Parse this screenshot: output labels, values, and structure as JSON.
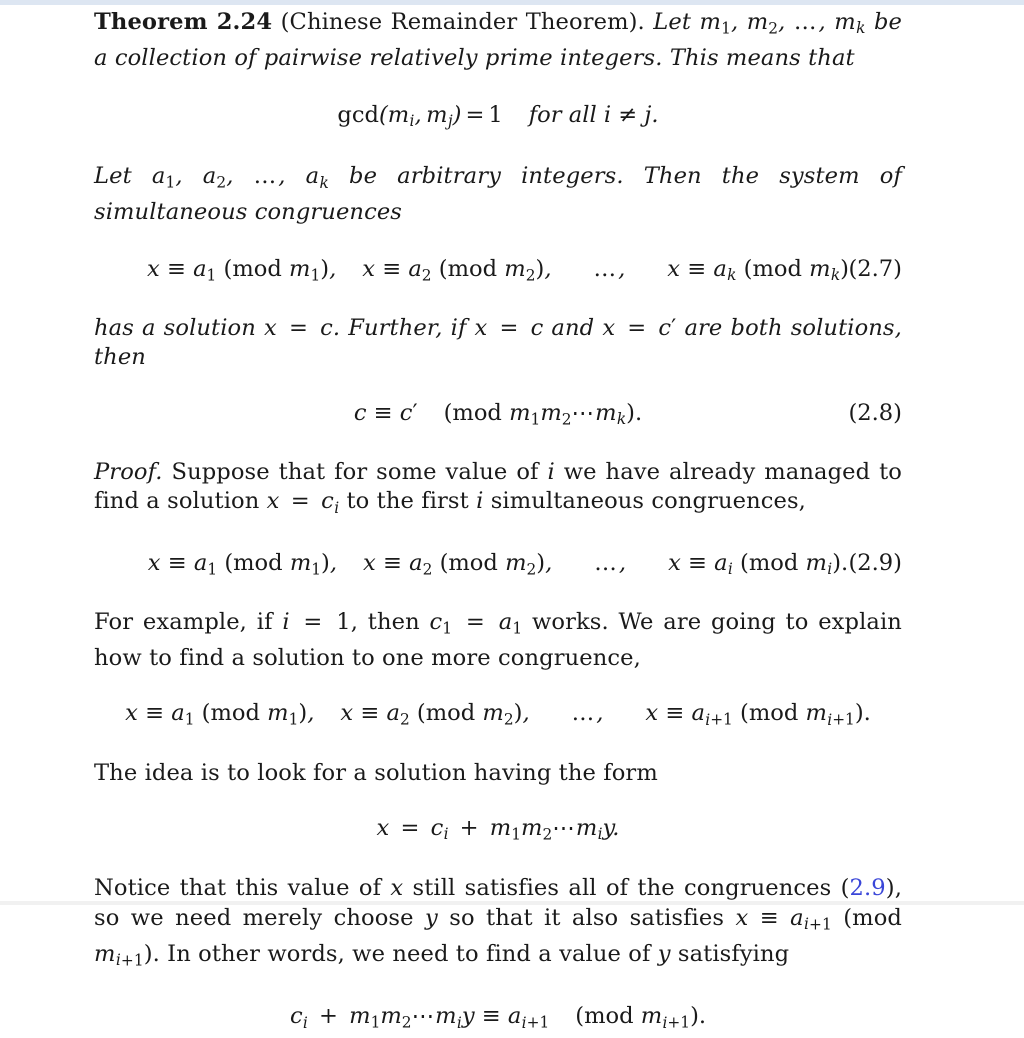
{
  "document": {
    "kind": "mathematics-textbook-page",
    "theorem": {
      "label": "Theorem 2.24",
      "name": "(Chinese Remainder Theorem).",
      "statement_line1": "Let m₁, m₂, …, m_k be a col-",
      "statement_line2": "lection of pairwise relatively prime integers. This means that",
      "body_text": "Let a₁, a₂, …, a_k be arbitrary integers. Then the system of simultaneous congruences",
      "after_eq27": "has a solution x = c. Further, if x = c and x = c′ are both solutions, then"
    },
    "proof": {
      "word": "Proof.",
      "p1": "Suppose that for some value of i we have already managed to find a solution x = c_i to the first i simultaneous congruences,",
      "p2": "For example, if i = 1, then c₁ = a₁ works. We are going to explain how to find a solution to one more congruence,",
      "p3": "The idea is to look for a solution having the form",
      "p4_a": "Notice that this value of ",
      "p4_b": " still satisfies all of the congruences ",
      "p4_ref": "2.9",
      "p4_c": ", so we need merely choose ",
      "p4_d": " so that it also satisfies ",
      "p4_e": ". In other words, we need to find a value of ",
      "p4_f": " satisfying"
    },
    "equations": {
      "gcd": {
        "text": "gcd(m_i, m_j) = 1   for all i ≠ j.",
        "tag": ""
      },
      "eq_2_7": {
        "text": "x ≡ a₁ (mod m₁),   x ≡ a₂ (mod m₂),   …,   x ≡ a_k (mod m_k)",
        "tag": "(2.7)"
      },
      "eq_2_8": {
        "text": "c ≡ c′   (mod m₁m₂⋯m_k).",
        "tag": "(2.8)"
      },
      "eq_2_9": {
        "text": "x ≡ a₁ (mod m₁),   x ≡ a₂ (mod m₂),   …,   x ≡ a_i (mod m_i).",
        "tag": "(2.9)"
      },
      "eq_next": {
        "text": "x ≡ a₁ (mod m₁),   x ≡ a₂ (mod m₂),   …,   x ≡ a_{i+1} (mod m_{i+1}).",
        "tag": ""
      },
      "eq_form": {
        "text": "x = c_i + m₁m₂⋯m_i y.",
        "tag": ""
      },
      "eq_final": {
        "text": "c_i + m₁m₂⋯m_i y ≡ a_{i+1}   (mod m_{i+1}).",
        "tag": ""
      }
    },
    "symbols": {
      "equiv": "≡",
      "neq": "≠",
      "cdots": "⋯",
      "ldots": "…",
      "mod": "mod",
      "gcd": "gcd",
      "prime": "′",
      "plus": "+",
      "equals": "="
    },
    "colors": {
      "text": "#1a1a1a",
      "link": "#3a46d8",
      "page_background": "#ffffff",
      "top_band": "#dde6f2"
    }
  }
}
